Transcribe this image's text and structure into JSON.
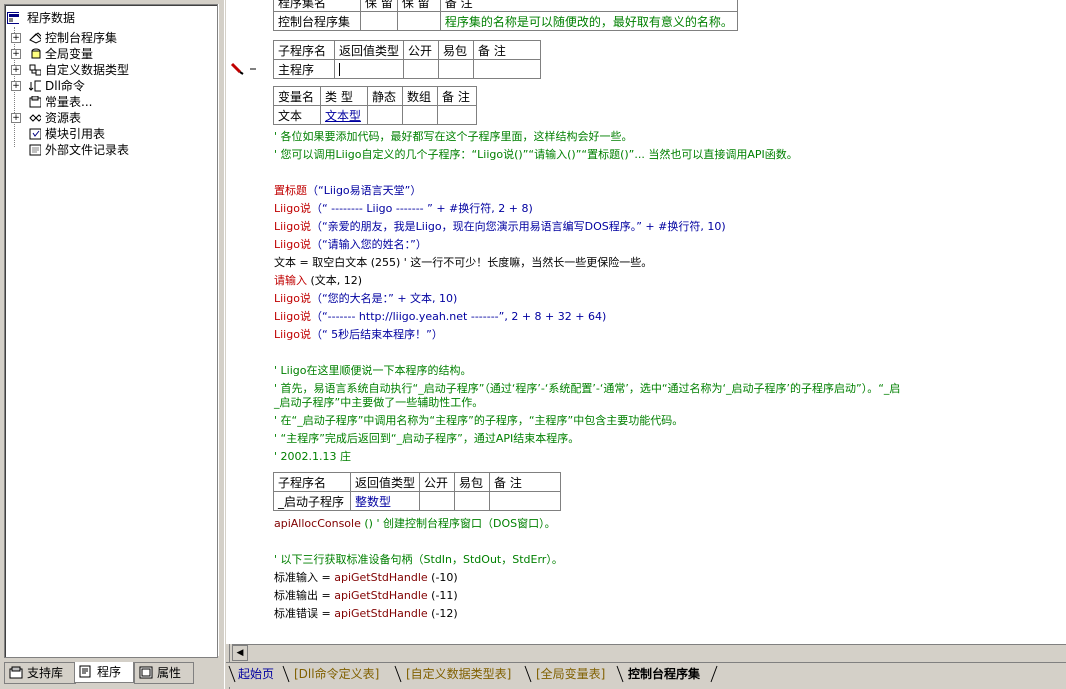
{
  "tree": {
    "root": "程序数据",
    "items": [
      {
        "label": "控制台程序集",
        "icon": "assembly-icon",
        "expandable": true
      },
      {
        "label": "全局变量",
        "icon": "global-var-icon",
        "expandable": true
      },
      {
        "label": "自定义数据类型",
        "icon": "datatype-icon",
        "expandable": true
      },
      {
        "label": "Dll命令",
        "icon": "dll-icon",
        "expandable": true
      },
      {
        "label": "常量表...",
        "icon": "constant-icon",
        "expandable": false
      },
      {
        "label": "资源表",
        "icon": "resource-icon",
        "expandable": true
      },
      {
        "label": "模块引用表",
        "icon": "module-icon",
        "expandable": false
      },
      {
        "label": "外部文件记录表",
        "icon": "file-record-icon",
        "expandable": false
      }
    ]
  },
  "left_tabs": [
    {
      "label": "支持库",
      "icon": "library-icon"
    },
    {
      "label": "程序",
      "icon": "program-icon"
    },
    {
      "label": "属性",
      "icon": "property-icon"
    }
  ],
  "assembly_table": {
    "headers": [
      "程序集名",
      "保 留",
      "保 留",
      "备 注"
    ],
    "row": [
      "控制台程序集",
      "",
      "",
      "程序集的名称是可以随便改的，最好取有意义的名称。"
    ]
  },
  "sub_table_main": {
    "headers": [
      "子程序名",
      "返回值类型",
      "公开",
      "易包",
      "备 注"
    ],
    "row": [
      "主程序",
      "",
      "",
      "",
      ""
    ]
  },
  "var_table": {
    "headers": [
      "变量名",
      "类 型",
      "静态",
      "数组",
      "备 注"
    ],
    "row": [
      "文本",
      "文本型",
      "",
      "",
      ""
    ]
  },
  "code_lines_1": [
    {
      "type": "cmt",
      "text": "' 各位如果要添加代码，最好都写在这个子程序里面，这样结构会好一些。"
    },
    {
      "type": "cmt",
      "text": "' 您可以调用Liigo自定义的几个子程序：“Liigo说()”“请输入()”“置标题()”...    当然也可以直接调用API函数。"
    }
  ],
  "code_lines_2": [
    {
      "fn": "置标题",
      "rest": "（“Liigo易语言天堂”）"
    },
    {
      "fn": "Liigo说",
      "rest": "（“          -------- Liigo -------    ” + #换行符, 2 + 8)"
    },
    {
      "fn": "Liigo说",
      "rest": "（“亲爱的朋友，我是Liigo，现在向您演示用易语言编写DOS程序。” + #换行符, 10)"
    },
    {
      "fn": "Liigo说",
      "rest": "（“请输入您的姓名：”）"
    },
    {
      "fn": "文本",
      "rest": " = 取空白文本 (255) ' 这一行不可少！长度嘛，当然长一些更保险一些。"
    },
    {
      "fn": "请输入",
      "rest": " (文本, 12)"
    },
    {
      "fn": "Liigo说",
      "rest": "（“您的大名是：” + 文本, 10)"
    },
    {
      "fn": "Liigo说",
      "rest": "（“------- http://liigo.yeah.net -------”, 2 + 8 + 32 + 64)"
    },
    {
      "fn": "Liigo说",
      "rest": "（“   5秒后结束本程序！”）"
    }
  ],
  "code_lines_3": [
    {
      "type": "cmt",
      "text": "' Liigo在这里顺便说一下本程序的结构。"
    },
    {
      "type": "cmt",
      "text": "' 首先，易语言系统自动执行“_启动子程序”（通过‘程序’-‘系统配置’-‘通常’，选中“通过名称为‘_启动子程序’的子程序启动”）。“_启"
    },
    {
      "type": "cmt",
      "text": "_启动子程序”中主要做了一些辅助性工作。"
    },
    {
      "type": "cmt",
      "text": "' 在“_启动子程序”中调用名称为“主程序”的子程序，“主程序”中包含主要功能代码。"
    },
    {
      "type": "cmt",
      "text": "' “主程序”完成后返回到“_启动子程序”，通过API结束本程序。"
    },
    {
      "type": "cmt",
      "text": "' 2002.1.13 庄"
    }
  ],
  "sub_table_start": {
    "headers": [
      "子程序名",
      "返回值类型",
      "公开",
      "易包",
      "备 注"
    ],
    "row": [
      "_启动子程序",
      "整数型",
      "",
      "",
      ""
    ]
  },
  "code_lines_4": {
    "alloc_fn": "apiAllocConsole",
    "alloc_rest": " () ' 创建控制台程序窗口（DOS窗口）。",
    "comment": "' 以下三行获取标准设备句柄（StdIn，StdOut，StdErr）。",
    "handles": [
      {
        "var": "标准输入",
        "call": "apiGetStdHandle",
        "arg": " (-10)"
      },
      {
        "var": "标准输出",
        "call": "apiGetStdHandle",
        "arg": " (-11)"
      },
      {
        "var": "标准错误",
        "call": "apiGetStdHandle",
        "arg": " (-12)"
      }
    ]
  },
  "bottom_tabs": [
    "起始页",
    "[Dll命令定义表]",
    "[自定义数据类型表]",
    "[全局变量表]",
    "控制台程序集"
  ]
}
